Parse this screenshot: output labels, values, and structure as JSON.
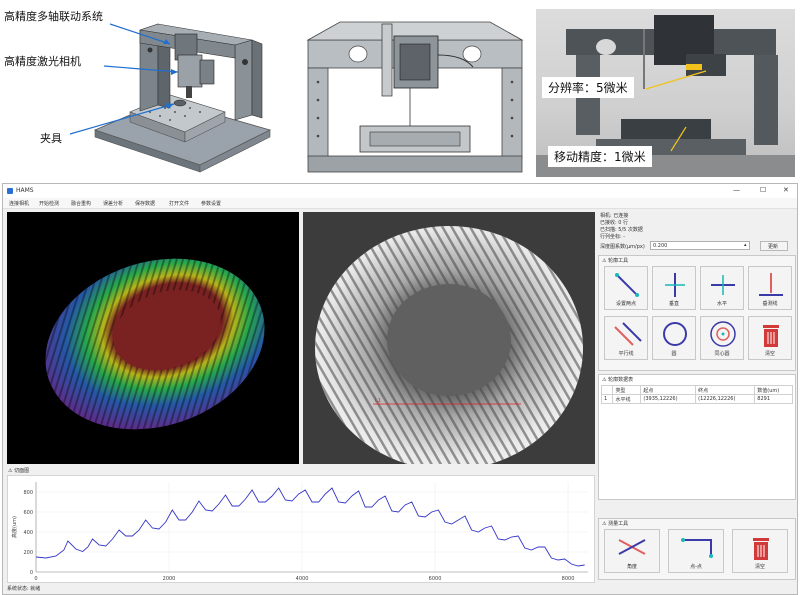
{
  "figure": {
    "drawing1_labels": [
      "高精度多轴联动系统",
      "高精度激光相机",
      "夹具"
    ],
    "photo_labels": [
      "分辨率：5微米",
      "移动精度：1微米"
    ]
  },
  "window": {
    "title": "HAMS",
    "controls": [
      "—",
      "☐",
      "✕"
    ]
  },
  "menu": [
    "连接相机",
    "开始检测",
    "融合重构",
    "误差分析",
    "保存数据",
    "打开文件",
    "参数设置"
  ],
  "status_info": {
    "line1": "相机: 已连接",
    "line2": "已接收: 0 行",
    "line3": "已扫描: 5/5 次数据",
    "line4": "行列坐标: -",
    "ratio_label": "深度图系数(μm/px)",
    "ratio_value": "0.200",
    "update_button": "更新"
  },
  "contour_tools": {
    "title": "轮廓工具",
    "buttons": [
      "设置两点",
      "垂直",
      "水平",
      "垂测线",
      "平行线",
      "圆",
      "同心圆",
      "清空"
    ]
  },
  "contour_data": {
    "title": "轮廓数据表",
    "columns": [
      "",
      "类型",
      "起点",
      "终点",
      "数值(um)"
    ],
    "rows": [
      [
        "1",
        "水平线",
        "(3935,12226)",
        "(12226,12226)",
        "8291"
      ]
    ]
  },
  "measure_tools": {
    "title": "测量工具",
    "buttons": [
      "角度",
      "点-点",
      "清空"
    ]
  },
  "section_panel": {
    "title": "切面图"
  },
  "status_bar": {
    "text": "系统状态: 就绪"
  },
  "image_overlay": {
    "line_label": "L1"
  },
  "chart_data": {
    "type": "line",
    "title": "",
    "xlabel": "",
    "ylabel": "高度(um)",
    "xlim": [
      0,
      8300
    ],
    "ylim": [
      0,
      900
    ],
    "xticks": [
      0,
      2000,
      4000,
      6000,
      8000
    ],
    "yticks": [
      0,
      200,
      400,
      600,
      800
    ],
    "series": [
      {
        "color": "#3535c8",
        "x": [
          0,
          150,
          300,
          420,
          480,
          600,
          700,
          780,
          850,
          950,
          1050,
          1150,
          1250,
          1350,
          1450,
          1550,
          1650,
          1750,
          1850,
          1950,
          2050,
          2150,
          2250,
          2350,
          2450,
          2550,
          2650,
          2750,
          2850,
          2950,
          3050,
          3150,
          3250,
          3350,
          3450,
          3550,
          3650,
          3750,
          3850,
          3950,
          4050,
          4150,
          4250,
          4350,
          4450,
          4550,
          4650,
          4750,
          4850,
          4950,
          5050,
          5150,
          5250,
          5350,
          5450,
          5550,
          5650,
          5750,
          5850,
          5950,
          6050,
          6150,
          6250,
          6350,
          6450,
          6550,
          6650,
          6750,
          6850,
          6950,
          7050,
          7150,
          7250,
          7350,
          7450,
          7550,
          7650,
          7750,
          7850,
          7950,
          8050,
          8150,
          8250
        ],
        "y": [
          150,
          140,
          160,
          220,
          310,
          230,
          205,
          250,
          330,
          270,
          260,
          330,
          420,
          360,
          360,
          420,
          520,
          440,
          430,
          500,
          620,
          520,
          520,
          600,
          710,
          620,
          610,
          680,
          770,
          660,
          660,
          730,
          820,
          700,
          700,
          760,
          840,
          720,
          710,
          780,
          820,
          700,
          700,
          780,
          840,
          700,
          690,
          760,
          810,
          650,
          650,
          720,
          760,
          610,
          600,
          670,
          700,
          560,
          550,
          600,
          620,
          500,
          480,
          520,
          560,
          420,
          400,
          440,
          460,
          330,
          320,
          350,
          360,
          240,
          220,
          250,
          250,
          140,
          120,
          130,
          80,
          60,
          70
        ]
      }
    ]
  }
}
